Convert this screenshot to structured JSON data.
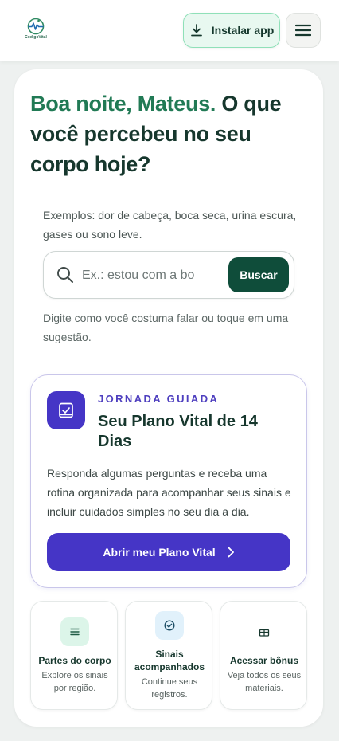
{
  "header": {
    "logo_text": "CódigoVital",
    "install_label": "Instalar app",
    "icons": {
      "install": "download-icon",
      "menu": "hamburger-menu-icon"
    }
  },
  "hero": {
    "greeting": "Boa noite, Mateus.",
    "question": "O que você percebeu no seu corpo hoje?",
    "examples": "Exemplos: dor de cabeça, boca seca, urina escura, gases ou sono leve.",
    "search_value": "",
    "search_placeholder": "Ex.: estou com a bo",
    "search_button": "Buscar",
    "hint": "Digite como você costuma falar ou toque em uma sugestão."
  },
  "journey": {
    "eyebrow": "JORNADA GUIADA",
    "title": "Seu Plano Vital de 14 Dias",
    "description": "Responda algumas perguntas e receba uma rotina organizada para acompanhar seus sinais e incluir cuidados simples no seu dia a dia.",
    "button_label": "Abrir meu Plano Vital"
  },
  "tiles": [
    {
      "title": "Partes do corpo",
      "subtitle": "Explore os sinais por região.",
      "icon": "list-icon",
      "color": "#dcf5e9"
    },
    {
      "title": "Sinais acompanhados",
      "subtitle": "Continue seus registros.",
      "icon": "check-circle-icon",
      "color": "#e1f1fb"
    },
    {
      "title": "Acessar bônus",
      "subtitle": "Veja todos os seus materiais.",
      "icon": "gift-icon",
      "color": "#ffffff"
    }
  ],
  "colors": {
    "brand_green": "#0f4d3a",
    "greeting_green": "#217a55",
    "journey_purple": "#4535c6"
  }
}
